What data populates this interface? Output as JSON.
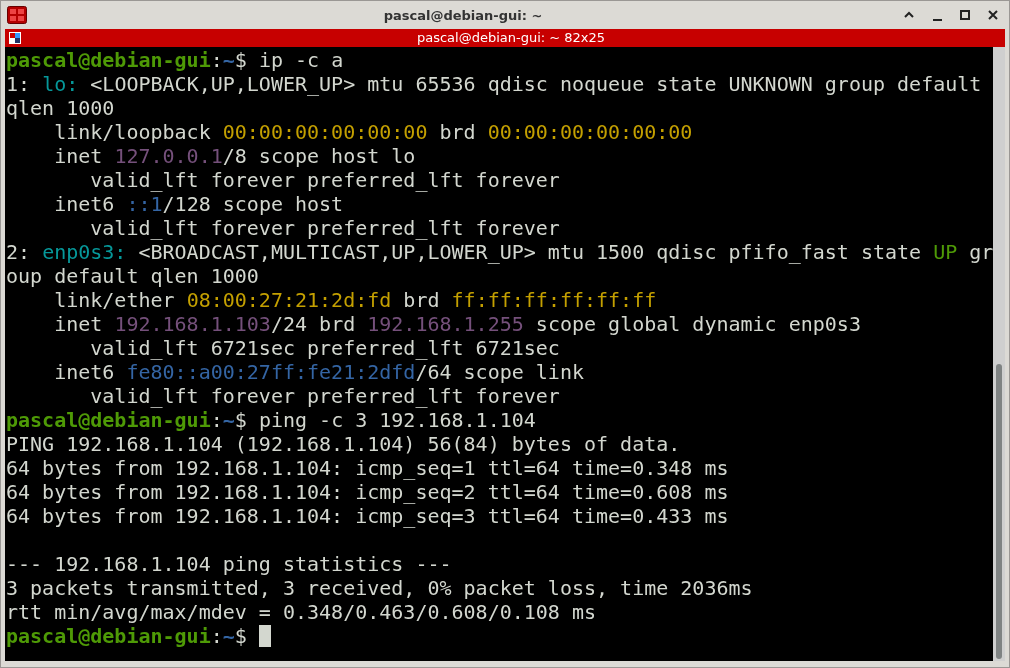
{
  "window": {
    "title": "pascal@debian-gui: ~"
  },
  "tab": {
    "title": "pascal@debian-gui: ~ 82x25"
  },
  "terminal": {
    "lines": [
      [
        {
          "kind": "user",
          "text": "pascal@debian-gui"
        },
        {
          "kind": "plain",
          "text": ":"
        },
        {
          "kind": "path",
          "text": "~"
        },
        {
          "kind": "plain",
          "text": "$ ip -c a"
        }
      ],
      [
        {
          "kind": "plain",
          "text": "1: "
        },
        {
          "kind": "iface",
          "text": "lo: "
        },
        {
          "kind": "plain",
          "text": "<LOOPBACK,UP,LOWER_UP> mtu 65536 qdisc noqueue state UNKNOWN group default"
        }
      ],
      [
        {
          "kind": "plain",
          "text": "qlen 1000"
        }
      ],
      [
        {
          "kind": "plain",
          "text": "    link/loopback "
        },
        {
          "kind": "mac",
          "text": "00:00:00:00:00:00"
        },
        {
          "kind": "plain",
          "text": " brd "
        },
        {
          "kind": "mac",
          "text": "00:00:00:00:00:00"
        }
      ],
      [
        {
          "kind": "plain",
          "text": "    inet "
        },
        {
          "kind": "ipv4",
          "text": "127.0.0.1"
        },
        {
          "kind": "plain",
          "text": "/8 scope host lo"
        }
      ],
      [
        {
          "kind": "plain",
          "text": "       valid_lft forever preferred_lft forever"
        }
      ],
      [
        {
          "kind": "plain",
          "text": "    inet6 "
        },
        {
          "kind": "ipv6",
          "text": "::1"
        },
        {
          "kind": "plain",
          "text": "/128 scope host"
        }
      ],
      [
        {
          "kind": "plain",
          "text": "       valid_lft forever preferred_lft forever"
        }
      ],
      [
        {
          "kind": "plain",
          "text": "2: "
        },
        {
          "kind": "iface",
          "text": "enp0s3: "
        },
        {
          "kind": "plain",
          "text": "<BROADCAST,MULTICAST,UP,LOWER_UP> mtu 1500 qdisc pfifo_fast state "
        },
        {
          "kind": "up",
          "text": "UP"
        },
        {
          "kind": "plain",
          "text": " gr"
        }
      ],
      [
        {
          "kind": "plain",
          "text": "oup default qlen 1000"
        }
      ],
      [
        {
          "kind": "plain",
          "text": "    link/ether "
        },
        {
          "kind": "mac",
          "text": "08:00:27:21:2d:fd"
        },
        {
          "kind": "plain",
          "text": " brd "
        },
        {
          "kind": "mac",
          "text": "ff:ff:ff:ff:ff:ff"
        }
      ],
      [
        {
          "kind": "plain",
          "text": "    inet "
        },
        {
          "kind": "ipv4",
          "text": "192.168.1.103"
        },
        {
          "kind": "plain",
          "text": "/24 brd "
        },
        {
          "kind": "ipv4",
          "text": "192.168.1.255"
        },
        {
          "kind": "plain",
          "text": " scope global dynamic enp0s3"
        }
      ],
      [
        {
          "kind": "plain",
          "text": "       valid_lft 6721sec preferred_lft 6721sec"
        }
      ],
      [
        {
          "kind": "plain",
          "text": "    inet6 "
        },
        {
          "kind": "ipv6",
          "text": "fe80::a00:27ff:fe21:2dfd"
        },
        {
          "kind": "plain",
          "text": "/64 scope link"
        }
      ],
      [
        {
          "kind": "plain",
          "text": "       valid_lft forever preferred_lft forever"
        }
      ],
      [
        {
          "kind": "user",
          "text": "pascal@debian-gui"
        },
        {
          "kind": "plain",
          "text": ":"
        },
        {
          "kind": "path",
          "text": "~"
        },
        {
          "kind": "plain",
          "text": "$ ping -c 3 192.168.1.104"
        }
      ],
      [
        {
          "kind": "plain",
          "text": "PING 192.168.1.104 (192.168.1.104) 56(84) bytes of data."
        }
      ],
      [
        {
          "kind": "plain",
          "text": "64 bytes from 192.168.1.104: icmp_seq=1 ttl=64 time=0.348 ms"
        }
      ],
      [
        {
          "kind": "plain",
          "text": "64 bytes from 192.168.1.104: icmp_seq=2 ttl=64 time=0.608 ms"
        }
      ],
      [
        {
          "kind": "plain",
          "text": "64 bytes from 192.168.1.104: icmp_seq=3 ttl=64 time=0.433 ms"
        }
      ],
      {
        "kind": "blank"
      },
      [
        {
          "kind": "plain",
          "text": "--- 192.168.1.104 ping statistics ---"
        }
      ],
      [
        {
          "kind": "plain",
          "text": "3 packets transmitted, 3 received, 0% packet loss, time 2036ms"
        }
      ],
      [
        {
          "kind": "plain",
          "text": "rtt min/avg/max/mdev = 0.348/0.463/0.608/0.108 ms"
        }
      ],
      [
        {
          "kind": "user",
          "text": "pascal@debian-gui"
        },
        {
          "kind": "plain",
          "text": ":"
        },
        {
          "kind": "path",
          "text": "~"
        },
        {
          "kind": "plain",
          "text": "$ "
        }
      ]
    ]
  }
}
